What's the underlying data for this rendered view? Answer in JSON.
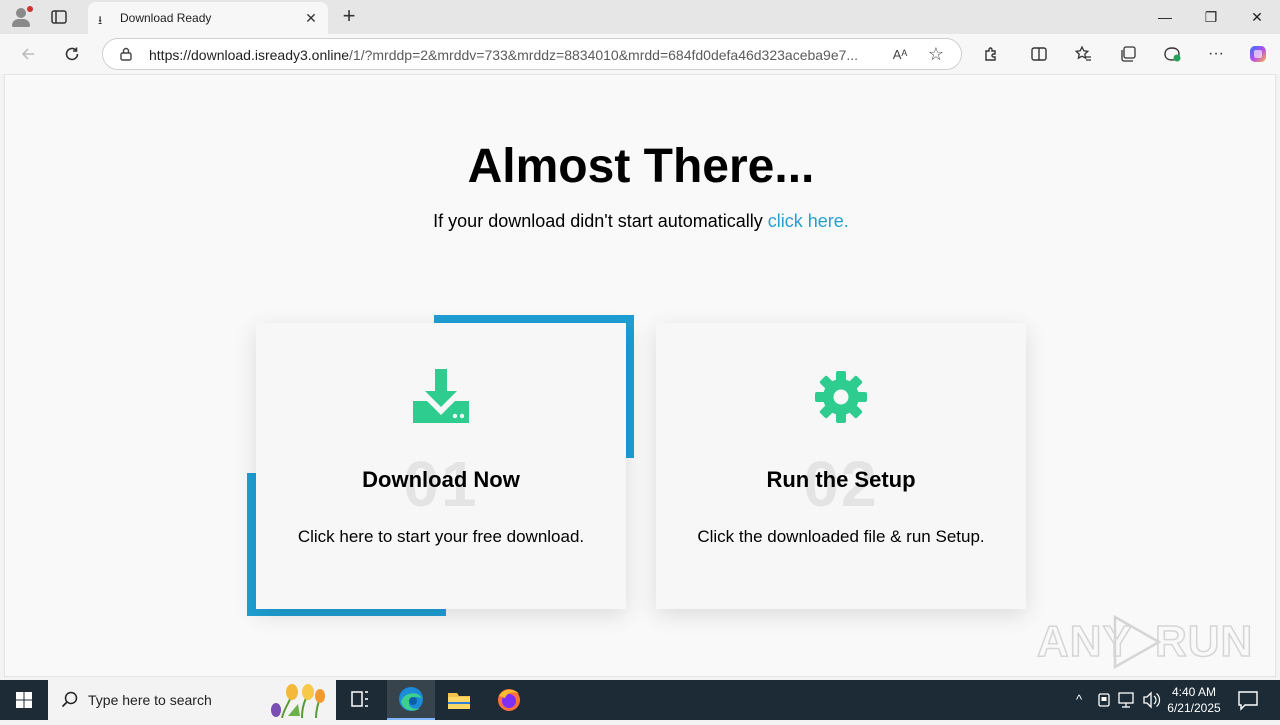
{
  "browser": {
    "tab_title": "Download Ready",
    "tab_close": "✕",
    "new_tab": "+",
    "url_host": "https://download.isready3.online",
    "url_rest": "/1/?mrddp=2&mrddv=733&mrddz=8834010&mrdd=684fd0defa46d323aceba9e7...",
    "window_controls": {
      "minimize": "—",
      "restore": "❐",
      "close": "✕"
    },
    "read_aloud": "Aᴬ",
    "favorite_star": "☆"
  },
  "page": {
    "headline": "Almost There...",
    "subline_text": "If your download didn't start automatically ",
    "subline_link": "click here.",
    "accent_color": "#1e9fd4",
    "icon_color": "#2ecc8f",
    "cards": [
      {
        "number": "01",
        "title": "Download Now",
        "description": "Click here to start your free download.",
        "icon": "download-icon"
      },
      {
        "number": "02",
        "title": "Run the Setup",
        "description": "Click the downloaded file & run Setup.",
        "icon": "gear-icon"
      }
    ],
    "watermark": "ANY RUN"
  },
  "taskbar": {
    "search_placeholder": "Type here to search",
    "time": "4:40 AM",
    "date": "6/21/2025",
    "tray_chevron": "^"
  }
}
